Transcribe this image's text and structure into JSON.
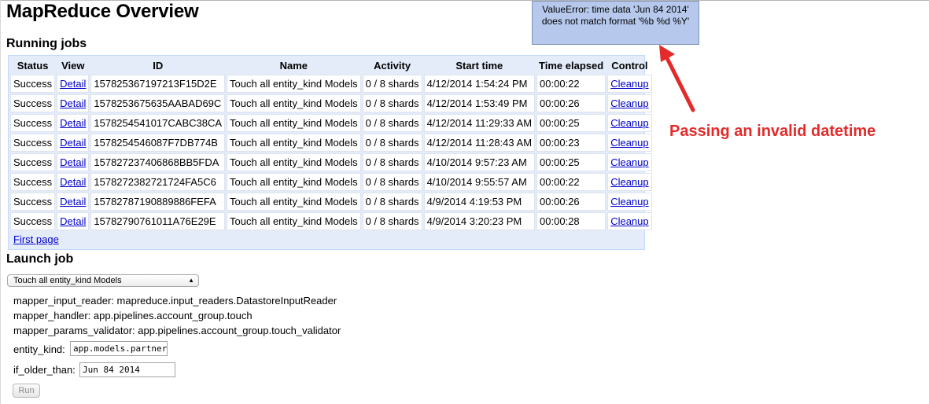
{
  "page": {
    "title": "MapReduce Overview"
  },
  "running_jobs": {
    "heading": "Running jobs",
    "columns": [
      "Status",
      "View",
      "ID",
      "Name",
      "Activity",
      "Start time",
      "Time elapsed",
      "Control"
    ],
    "rows": [
      {
        "status": "Success",
        "view": "Detail",
        "id": "1578253671972​13F15D2E",
        "name": "Touch all entity_kind Models",
        "activity": "0 / 8 shards",
        "start": "4/12/2014 1:54:24 PM",
        "elapsed": "00:00:22",
        "control": "Cleanup"
      },
      {
        "status": "Success",
        "view": "Detail",
        "id": "1578253675635AABAD69C",
        "name": "Touch all entity_kind Models",
        "activity": "0 / 8 shards",
        "start": "4/12/2014 1:53:49 PM",
        "elapsed": "00:00:26",
        "control": "Cleanup"
      },
      {
        "status": "Success",
        "view": "Detail",
        "id": "1578254541017CABC38CA",
        "name": "Touch all entity_kind Models",
        "activity": "0 / 8 shards",
        "start": "4/12/2014 11:29:33 AM",
        "elapsed": "00:00:25",
        "control": "Cleanup"
      },
      {
        "status": "Success",
        "view": "Detail",
        "id": "1578254546087F7DB774B",
        "name": "Touch all entity_kind Models",
        "activity": "0 / 8 shards",
        "start": "4/12/2014 11:28:43 AM",
        "elapsed": "00:00:23",
        "control": "Cleanup"
      },
      {
        "status": "Success",
        "view": "Detail",
        "id": "157827237406868BB5FDA",
        "name": "Touch all entity_kind Models",
        "activity": "0 / 8 shards",
        "start": "4/10/2014 9:57:23 AM",
        "elapsed": "00:00:25",
        "control": "Cleanup"
      },
      {
        "status": "Success",
        "view": "Detail",
        "id": "157827238272172​4FA5C6",
        "name": "Touch all entity_kind Models",
        "activity": "0 / 8 shards",
        "start": "4/10/2014 9:55:57 AM",
        "elapsed": "00:00:22",
        "control": "Cleanup"
      },
      {
        "status": "Success",
        "view": "Detail",
        "id": "15782787190889886FEFA",
        "name": "Touch all entity_kind Models",
        "activity": "0 / 8 shards",
        "start": "4/9/2014 4:19:53 PM",
        "elapsed": "00:00:26",
        "control": "Cleanup"
      },
      {
        "status": "Success",
        "view": "Detail",
        "id": "15782790761011A76E29E",
        "name": "Touch all entity_kind Models",
        "activity": "0 / 8 shards",
        "start": "4/9/2014 3:20:23 PM",
        "elapsed": "00:00:28",
        "control": "Cleanup"
      }
    ],
    "first_page_link": "First page"
  },
  "launch_job": {
    "heading": "Launch job",
    "selected_job": "Touch all entity_kind Models",
    "mapper_input_reader": "mapper_input_reader: mapreduce.input_readers.DatastoreInputReader",
    "mapper_handler": "mapper_handler: app.pipelines.account_group.touch",
    "mapper_params_validator": "mapper_params_validator: app.pipelines.account_group.touch_validator",
    "entity_kind_label": "entity_kind:",
    "entity_kind_value": "app.models.partner.Pa",
    "if_older_than_label": "if_older_than:",
    "if_older_than_value": "Jun 84 2014",
    "run_label": "Run"
  },
  "error_tooltip": {
    "text": "ValueError: time data 'Jun 84 2014' does not match format '%b %d %Y'"
  },
  "annotation": {
    "text": "Passing an invalid datetime",
    "color": "#e32b2b"
  },
  "colors": {
    "table_bg": "#e5ecf9",
    "link": "#0000cc",
    "tooltip_bg": "#b6c8ec"
  }
}
